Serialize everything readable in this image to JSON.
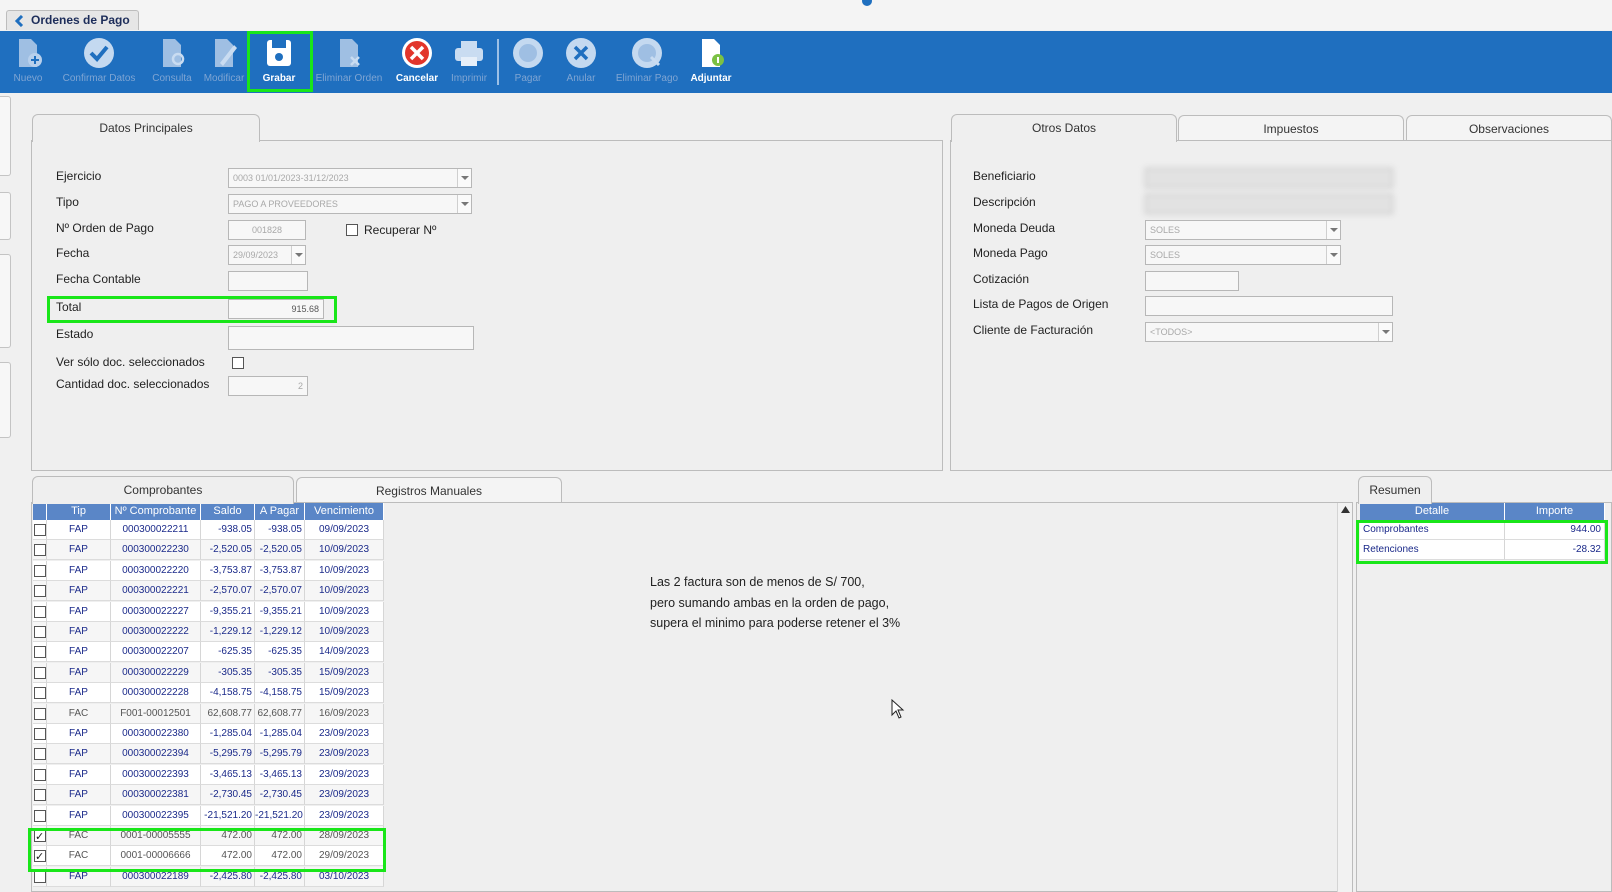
{
  "window": {
    "tab_title": "Ordenes de Pago"
  },
  "toolbar": {
    "buttons": [
      {
        "label": "Nuevo",
        "icon": "new-doc-icon",
        "enabled": false
      },
      {
        "label": "Confirmar Datos",
        "icon": "check-circle-icon",
        "enabled": false
      },
      {
        "label": "Consulta",
        "icon": "search-doc-icon",
        "enabled": false
      },
      {
        "label": "Modificar",
        "icon": "edit-doc-icon",
        "enabled": false
      },
      {
        "label": "Grabar",
        "icon": "save-icon",
        "enabled": true
      },
      {
        "label": "Eliminar Orden",
        "icon": "delete-doc-icon",
        "enabled": false
      },
      {
        "label": "Cancelar",
        "icon": "cancel-icon",
        "enabled": true
      },
      {
        "label": "Imprimir",
        "icon": "printer-icon",
        "enabled": false
      },
      {
        "label": "Pagar",
        "icon": "pay-icon",
        "enabled": false
      },
      {
        "label": "Anular",
        "icon": "void-icon",
        "enabled": false
      },
      {
        "label": "Eliminar Pago",
        "icon": "delete-payment-icon",
        "enabled": false
      },
      {
        "label": "Adjuntar",
        "icon": "attach-icon",
        "enabled": true
      }
    ]
  },
  "main_tabs": {
    "left": [
      "Datos Principales"
    ],
    "right": [
      "Otros Datos",
      "Impuestos",
      "Observaciones"
    ]
  },
  "datos_principales": {
    "ejercicio": {
      "label": "Ejercicio",
      "value": "0003 01/01/2023-31/12/2023"
    },
    "tipo": {
      "label": "Tipo",
      "value": "PAGO A PROVEEDORES"
    },
    "nro_orden": {
      "label": "Nº Orden de Pago",
      "value": "001828"
    },
    "recuperar": {
      "label": "Recuperar Nº",
      "checked": false
    },
    "fecha": {
      "label": "Fecha",
      "value": "29/09/2023"
    },
    "fecha_contable": {
      "label": "Fecha Contable",
      "value": ""
    },
    "total": {
      "label": "Total",
      "value": "915.68"
    },
    "estado": {
      "label": "Estado",
      "value": ""
    },
    "ver_solo": {
      "label": "Ver sólo doc. seleccionados",
      "checked": false
    },
    "cantidad": {
      "label": "Cantidad doc. seleccionados",
      "value": "2"
    }
  },
  "otros_datos": {
    "beneficiario": {
      "label": "Beneficiario",
      "value": ""
    },
    "descripcion": {
      "label": "Descripción",
      "value": ""
    },
    "moneda_deuda": {
      "label": "Moneda Deuda",
      "value": "SOLES"
    },
    "moneda_pago": {
      "label": "Moneda Pago",
      "value": "SOLES"
    },
    "cotizacion": {
      "label": "Cotización",
      "value": ""
    },
    "lista_pagos": {
      "label": "Lista de Pagos de Origen",
      "value": ""
    },
    "cliente_fact": {
      "label": "Cliente de Facturación",
      "value": "<TODOS>"
    }
  },
  "lower_tabs": [
    "Comprobantes",
    "Registros Manuales"
  ],
  "comprobantes": {
    "columns": [
      "Tip",
      "Nº Comprobante",
      "Saldo",
      "A Pagar",
      "Vencimiento"
    ],
    "rows": [
      {
        "checked": false,
        "tip": "FAP",
        "num": "000300022211",
        "saldo": "-938.05",
        "apagar": "-938.05",
        "venc": "09/09/2023"
      },
      {
        "checked": false,
        "tip": "FAP",
        "num": "000300022230",
        "saldo": "-2,520.05",
        "apagar": "-2,520.05",
        "venc": "10/09/2023"
      },
      {
        "checked": false,
        "tip": "FAP",
        "num": "000300022220",
        "saldo": "-3,753.87",
        "apagar": "-3,753.87",
        "venc": "10/09/2023"
      },
      {
        "checked": false,
        "tip": "FAP",
        "num": "000300022221",
        "saldo": "-2,570.07",
        "apagar": "-2,570.07",
        "venc": "10/09/2023"
      },
      {
        "checked": false,
        "tip": "FAP",
        "num": "000300022227",
        "saldo": "-9,355.21",
        "apagar": "-9,355.21",
        "venc": "10/09/2023"
      },
      {
        "checked": false,
        "tip": "FAP",
        "num": "000300022222",
        "saldo": "-1,229.12",
        "apagar": "-1,229.12",
        "venc": "10/09/2023"
      },
      {
        "checked": false,
        "tip": "FAP",
        "num": "000300022207",
        "saldo": "-625.35",
        "apagar": "-625.35",
        "venc": "14/09/2023"
      },
      {
        "checked": false,
        "tip": "FAP",
        "num": "000300022229",
        "saldo": "-305.35",
        "apagar": "-305.35",
        "venc": "15/09/2023"
      },
      {
        "checked": false,
        "tip": "FAP",
        "num": "000300022228",
        "saldo": "-4,158.75",
        "apagar": "-4,158.75",
        "venc": "15/09/2023"
      },
      {
        "checked": false,
        "tip": "FAC",
        "num": "F001-00012501",
        "saldo": "62,608.77",
        "apagar": "62,608.77",
        "venc": "16/09/2023"
      },
      {
        "checked": false,
        "tip": "FAP",
        "num": "000300022380",
        "saldo": "-1,285.04",
        "apagar": "-1,285.04",
        "venc": "23/09/2023"
      },
      {
        "checked": false,
        "tip": "FAP",
        "num": "000300022394",
        "saldo": "-5,295.79",
        "apagar": "-5,295.79",
        "venc": "23/09/2023"
      },
      {
        "checked": false,
        "tip": "FAP",
        "num": "000300022393",
        "saldo": "-3,465.13",
        "apagar": "-3,465.13",
        "venc": "23/09/2023"
      },
      {
        "checked": false,
        "tip": "FAP",
        "num": "000300022381",
        "saldo": "-2,730.45",
        "apagar": "-2,730.45",
        "venc": "23/09/2023"
      },
      {
        "checked": false,
        "tip": "FAP",
        "num": "000300022395",
        "saldo": "-21,521.20",
        "apagar": "-21,521.20",
        "venc": "23/09/2023"
      },
      {
        "checked": true,
        "tip": "FAC",
        "num": "0001-00005555",
        "saldo": "472.00",
        "apagar": "472.00",
        "venc": "28/09/2023"
      },
      {
        "checked": true,
        "tip": "FAC",
        "num": "0001-00006666",
        "saldo": "472.00",
        "apagar": "472.00",
        "venc": "29/09/2023"
      },
      {
        "checked": false,
        "tip": "FAP",
        "num": "000300022189",
        "saldo": "-2,425.80",
        "apagar": "-2,425.80",
        "venc": "03/10/2023"
      }
    ]
  },
  "note": {
    "lines": [
      "Las 2 factura son de menos de S/ 700,",
      "pero sumando ambas en la orden de pago,",
      "supera el minimo para poderse retener el 3%"
    ]
  },
  "resumen": {
    "tab": "Resumen",
    "columns": [
      "Detalle",
      "Importe"
    ],
    "rows": [
      {
        "detalle": "Comprobantes",
        "importe": "944.00"
      },
      {
        "detalle": "Retenciones",
        "importe": "-28.32"
      }
    ]
  },
  "colors": {
    "toolbar": "#1f6fbf",
    "grid_header": "#5a86c7",
    "highlight": "#19e619"
  }
}
